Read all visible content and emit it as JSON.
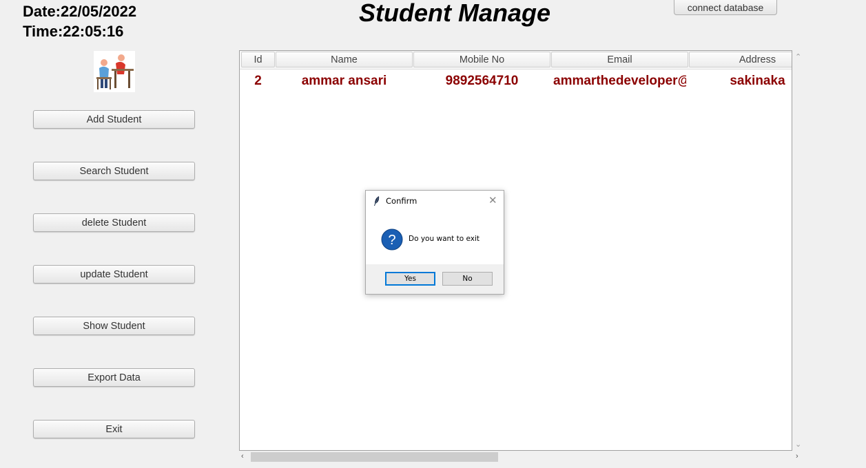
{
  "header": {
    "date": "Date:22/05/2022",
    "time": "Time:22:05:16",
    "title": "Student Manage",
    "connect_label": "connect database"
  },
  "sidebar": {
    "buttons": [
      {
        "label": "Add Student"
      },
      {
        "label": "Search Student"
      },
      {
        "label": "delete Student"
      },
      {
        "label": "update Student"
      },
      {
        "label": "Show Student"
      },
      {
        "label": "Export Data"
      },
      {
        "label": "Exit"
      }
    ]
  },
  "table": {
    "columns": [
      "Id",
      "Name",
      "Mobile No",
      "Email",
      "Address"
    ],
    "rows": [
      [
        "2",
        "ammar ansari",
        "9892564710",
        "ammarthedeveloper@",
        "sakinaka"
      ]
    ]
  },
  "dialog": {
    "title": "Confirm",
    "message": "Do you want to exit",
    "yes_label": "Yes",
    "no_label": "No"
  },
  "colors": {
    "row_text": "#8b0000",
    "dialog_accent": "#0078d7",
    "question_icon": "#1a5fb4"
  },
  "icons": [
    "students-logo-icon",
    "feather-icon",
    "close-icon",
    "question-icon",
    "scroll-up-icon",
    "scroll-down-icon",
    "scroll-left-icon",
    "scroll-right-icon"
  ]
}
